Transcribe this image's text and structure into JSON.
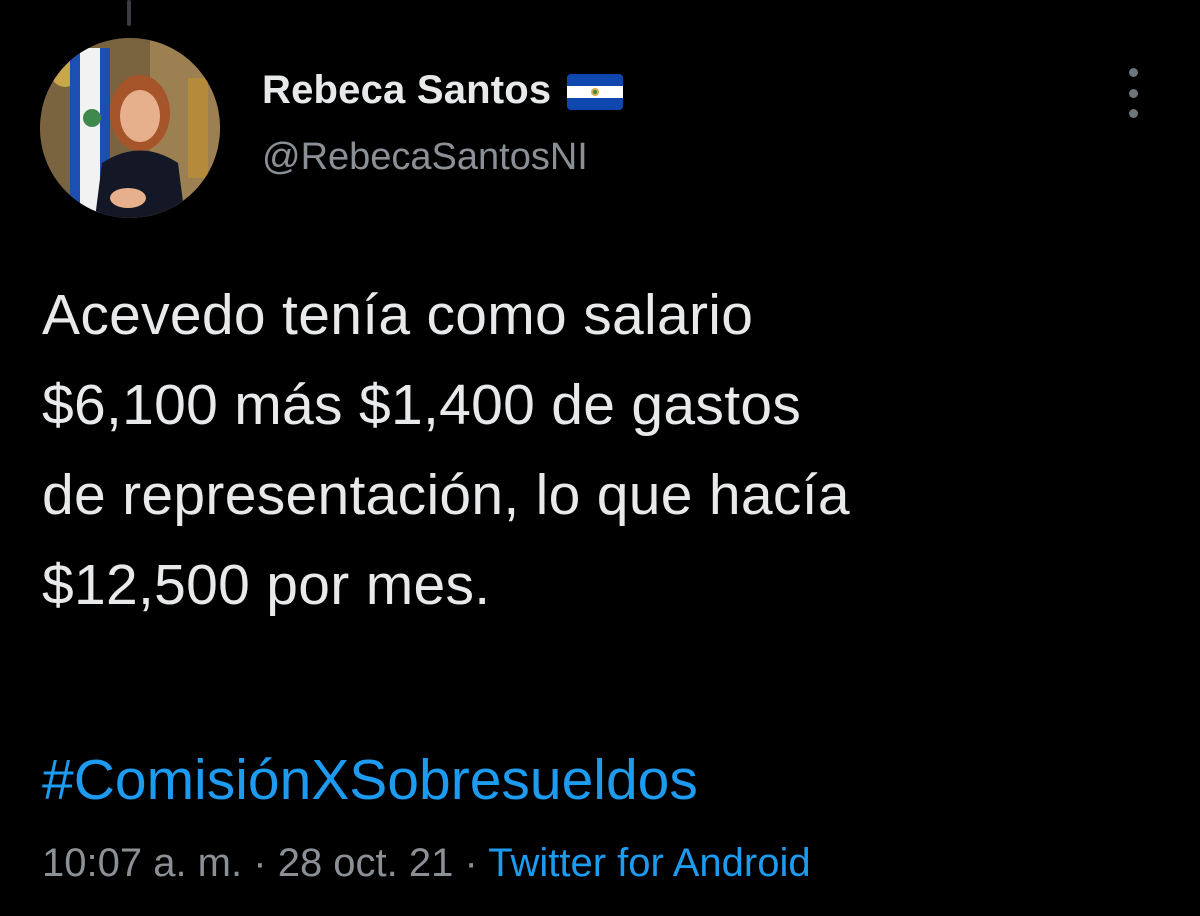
{
  "author": {
    "display_name": "Rebeca Santos",
    "handle": "@RebecaSantosNI",
    "flag_icon": "el-salvador-flag-icon",
    "avatar_icon": "profile-photo-avatar"
  },
  "tweet": {
    "lines": [
      "Acevedo tenía como salario",
      "$6,100 más $1,400 de gastos",
      "de representación, lo que hacía",
      "$12,500 por mes."
    ],
    "hashtag": "#ComisiónXSobresueldos"
  },
  "meta": {
    "time": "10:07 a. m.",
    "separator": "·",
    "date": "28 oct. 21",
    "source": "Twitter for Android"
  },
  "colors": {
    "background": "#000000",
    "text_primary": "#e7e9ea",
    "text_secondary": "#8b9096",
    "link": "#1d9bf0",
    "flag_blue": "#0f47af"
  }
}
